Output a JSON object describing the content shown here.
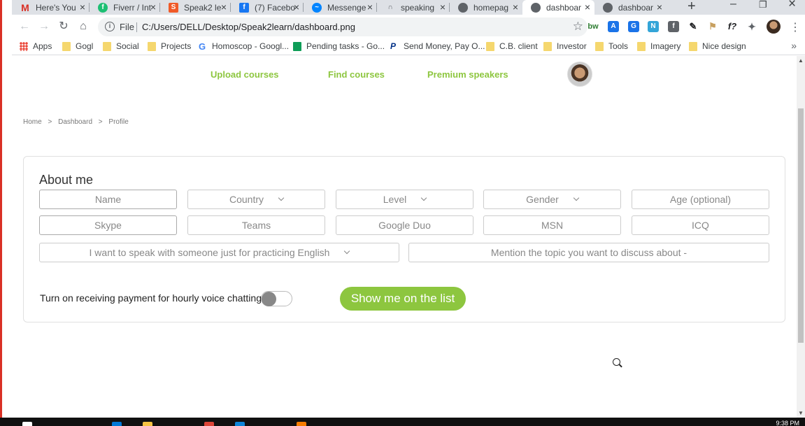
{
  "browser": {
    "tabs": [
      {
        "title": "Here's You",
        "icon": "gmail-icon",
        "color": "#d93025",
        "active": false
      },
      {
        "title": "Fiverr / Int",
        "icon": "fiverr-icon",
        "color": "#1dbf73",
        "active": false
      },
      {
        "title": "Speak2 le",
        "icon": "speak2-icon",
        "color": "#f05a28",
        "active": false
      },
      {
        "title": "(7) Facebo",
        "icon": "facebook-icon",
        "color": "#1877f2",
        "active": false
      },
      {
        "title": "Messenge",
        "icon": "messenger-icon",
        "color": "#0084ff",
        "active": false
      },
      {
        "title": "speaking",
        "icon": "speaking-icon",
        "color": "#5f6368",
        "active": false
      },
      {
        "title": "homepag",
        "icon": "globe-icon",
        "color": "#5f6368",
        "active": false
      },
      {
        "title": "dashboar",
        "icon": "globe-icon",
        "color": "#5f6368",
        "active": true
      },
      {
        "title": "dashboar",
        "icon": "globe-icon",
        "color": "#5f6368",
        "active": false
      }
    ],
    "new_tab_label": "+",
    "close_glyph": "×",
    "scheme": "File",
    "url": "C:/Users/DELL/Desktop/Speak2learn/dashboard.png",
    "extensions": [
      {
        "label": "bw",
        "name": "bw-extension-icon",
        "color": "#2e7d32"
      },
      {
        "label": "A",
        "name": "translate-extension-icon",
        "color": "#1a73e8"
      },
      {
        "label": "G",
        "name": "copy-extension-icon",
        "color": "#1a73e8"
      },
      {
        "label": "N",
        "name": "notion-extension-icon",
        "color": "#34a5d8"
      },
      {
        "label": "f",
        "name": "facebook-extension-icon",
        "color": "#5f6368"
      },
      {
        "label": "✎",
        "name": "stylus-extension-icon",
        "color": "#202124"
      },
      {
        "label": "⚑",
        "name": "flag-extension-icon",
        "color": "#c8a060"
      },
      {
        "label": "f?",
        "name": "whatfont-extension-icon",
        "color": "#202124"
      },
      {
        "label": "✦",
        "name": "puzzle-extension-icon",
        "color": "#5f6368"
      }
    ],
    "bookmarks": [
      {
        "label": "Apps",
        "icon": "apps-icon"
      },
      {
        "label": "Gogl",
        "icon": "folder-icon"
      },
      {
        "label": "Social",
        "icon": "folder-icon"
      },
      {
        "label": "Projects",
        "icon": "folder-icon"
      },
      {
        "label": "Homoscop - Googl...",
        "icon": "google-icon"
      },
      {
        "label": "Pending tasks - Go...",
        "icon": "sheets-icon"
      },
      {
        "label": "Send Money, Pay O...",
        "icon": "paypal-icon"
      },
      {
        "label": "C.B. client",
        "icon": "folder-icon"
      },
      {
        "label": "Investor",
        "icon": "folder-icon"
      },
      {
        "label": "Tools",
        "icon": "folder-icon"
      },
      {
        "label": "Imagery",
        "icon": "folder-icon"
      },
      {
        "label": "Nice design",
        "icon": "folder-icon"
      }
    ],
    "bookmarks_more": "»"
  },
  "site": {
    "accent": "#8dc63f",
    "nav": {
      "upload": "Upload courses",
      "find": "Find courses",
      "premium": "Premium speakers"
    },
    "breadcrumb": [
      "Home",
      ">",
      "Dashboard",
      ">",
      "Profile"
    ],
    "about_title": "About me",
    "fields_row1": [
      "Name",
      "Country",
      "Level",
      "Gender",
      "Age (optional)"
    ],
    "fields_row2": [
      "Skype",
      "Teams",
      "Google Duo",
      "MSN",
      "ICQ"
    ],
    "purpose_select": "I want to speak with someone just for practicing English",
    "topic_field": "Mention the topic you want to discuss about -",
    "payment_question": "Turn on receiving payment for hourly voice chatting?",
    "payment_toggle_on": false,
    "show_button": "Show me on the list"
  },
  "taskbar": {
    "clock": "9:38 PM"
  }
}
